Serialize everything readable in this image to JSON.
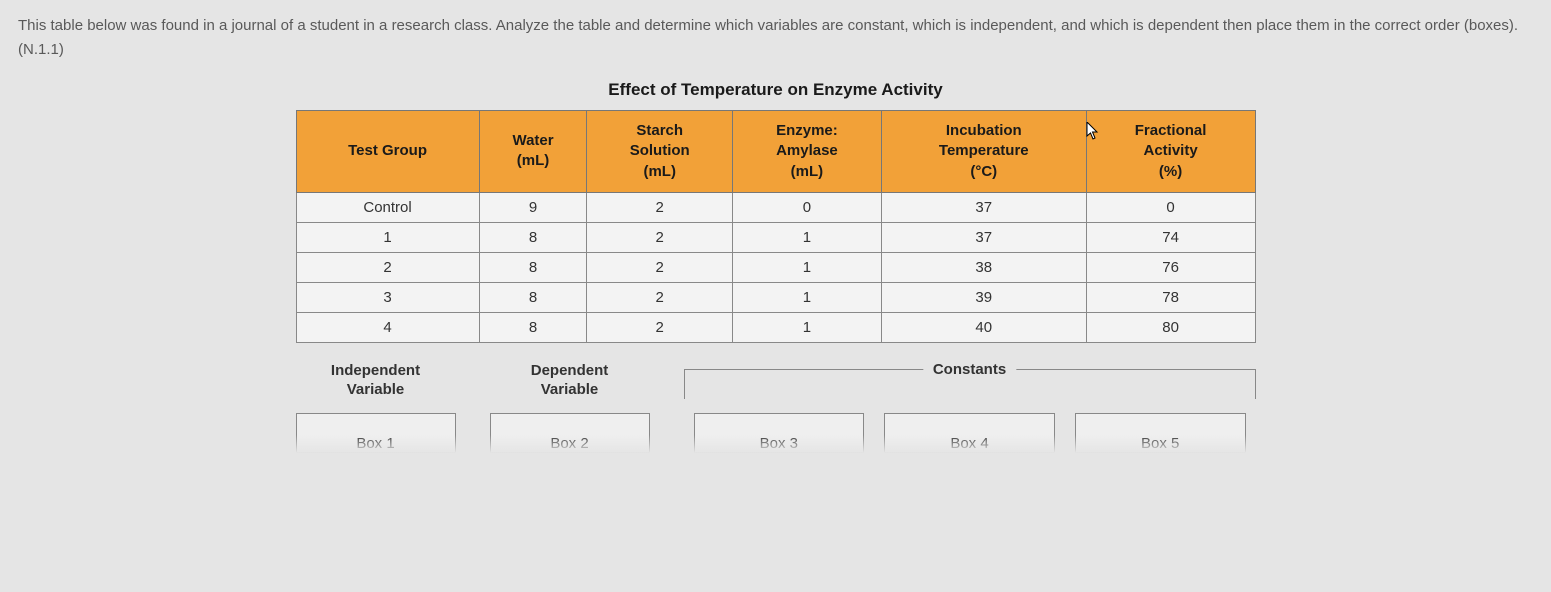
{
  "prompt": "This table below was found in a journal of a student in a research class. Analyze the table and determine which variables are constant, which is independent, and which is dependent then place them in the correct order (boxes). (N.1.1)",
  "table": {
    "title": "Effect of Temperature on Enzyme Activity",
    "headers": [
      "Test Group",
      "Water\n(mL)",
      "Starch\nSolution\n(mL)",
      "Enzyme:\nAmylase\n(mL)",
      "Incubation\nTemperature\n(°C)",
      "Fractional\nActivity\n(%)"
    ],
    "rows": [
      [
        "Control",
        "9",
        "2",
        "0",
        "37",
        "0"
      ],
      [
        "1",
        "8",
        "2",
        "1",
        "37",
        "74"
      ],
      [
        "2",
        "8",
        "2",
        "1",
        "38",
        "76"
      ],
      [
        "3",
        "8",
        "2",
        "1",
        "39",
        "78"
      ],
      [
        "4",
        "8",
        "2",
        "1",
        "40",
        "80"
      ]
    ]
  },
  "answer": {
    "independent_label": "Independent\nVariable",
    "dependent_label": "Dependent\nVariable",
    "constants_label": "Constants",
    "boxes": [
      "Box 1",
      "Box 2",
      "Box 3",
      "Box 4",
      "Box 5"
    ]
  }
}
